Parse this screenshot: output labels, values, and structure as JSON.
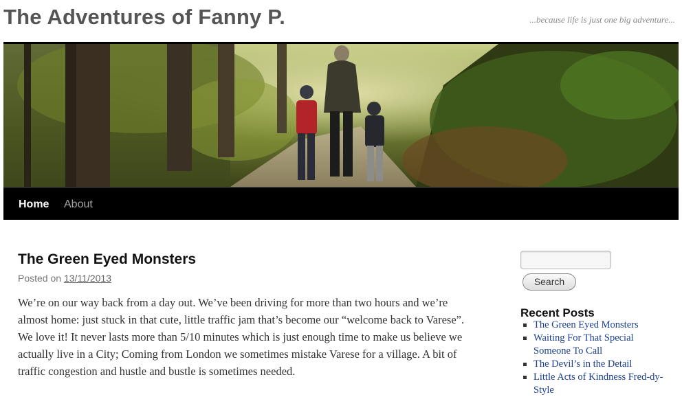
{
  "site": {
    "title": "The Adventures of Fanny P.",
    "tagline": "...because life is just one big adventure..."
  },
  "nav": {
    "items": [
      {
        "label": "Home",
        "active": true
      },
      {
        "label": "About",
        "active": false
      }
    ]
  },
  "post": {
    "title": "The Green Eyed Monsters",
    "posted_on_label": "Posted on",
    "date": "13/11/2013",
    "body": "We’re on our way back from a day out. We’ve been driving for more than two hours and we’re almost home: just stuck in that cute, little traffic jam that’s become our “welcome back to Varese”. We love it! It never lasts more than 5/10 minutes which is just enough time to make us believe we actually live in a City; Coming from London we sometimes mistake Varese for a village. A bit of traffic congestion and hustle and bustle is sometimes needed."
  },
  "sidebar": {
    "search": {
      "value": "",
      "button_label": "Search"
    },
    "recent_posts": {
      "heading": "Recent Posts",
      "items": [
        "The Green Eyed Monsters",
        "Waiting For That Special Someone To Call",
        "The Devil’s in the Detail",
        "Little Acts of Kindness Fred-dy-Style"
      ]
    }
  },
  "colors": {
    "title_gray": "#555555",
    "nav_bg": "#000000",
    "link_blue": "#1b3f8f"
  }
}
